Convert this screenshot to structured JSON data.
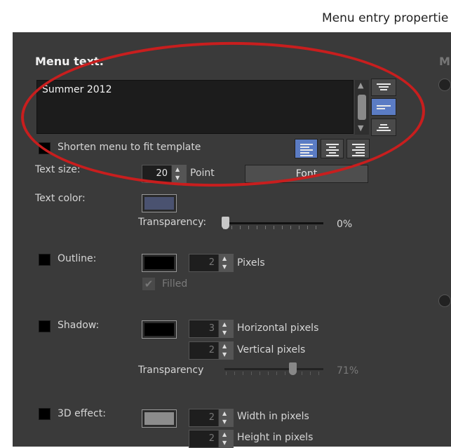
{
  "window": {
    "title": "Menu entry propertie"
  },
  "menu_text": {
    "label": "Menu text:",
    "value": "Summer 2012",
    "shorten_label": "Shorten menu to fit template",
    "shorten_checked": false
  },
  "text_size": {
    "label": "Text size:",
    "value": "20",
    "unit": "Point",
    "font_button": "Font"
  },
  "text_color": {
    "label": "Text color:",
    "color": "#4a5270",
    "transparency_label": "Transparency:",
    "transparency_value": "0%",
    "transparency_level": 0
  },
  "outline": {
    "label": "Outline:",
    "checked": false,
    "color": "#000000",
    "value": "2",
    "unit": "Pixels",
    "filled_label": "Filled",
    "filled_checked": true
  },
  "shadow": {
    "label": "Shadow:",
    "checked": false,
    "color": "#000000",
    "h_value": "3",
    "h_label": "Horizontal pixels",
    "v_value": "2",
    "v_label": "Vertical pixels",
    "transparency_label": "Transparency",
    "transparency_value": "71%",
    "transparency_level": 0.71
  },
  "effect3d": {
    "label": "3D effect:",
    "checked": false,
    "color": "#8c8c8c",
    "w_value": "2",
    "w_label": "Width in pixels",
    "h_value": "2",
    "h_label": "Height in pixels"
  },
  "right_panel": {
    "label": "M"
  },
  "colors": {
    "panel": "#3a3a3a",
    "accent": "#5b7cc4",
    "annotation": "#c81e1e"
  }
}
